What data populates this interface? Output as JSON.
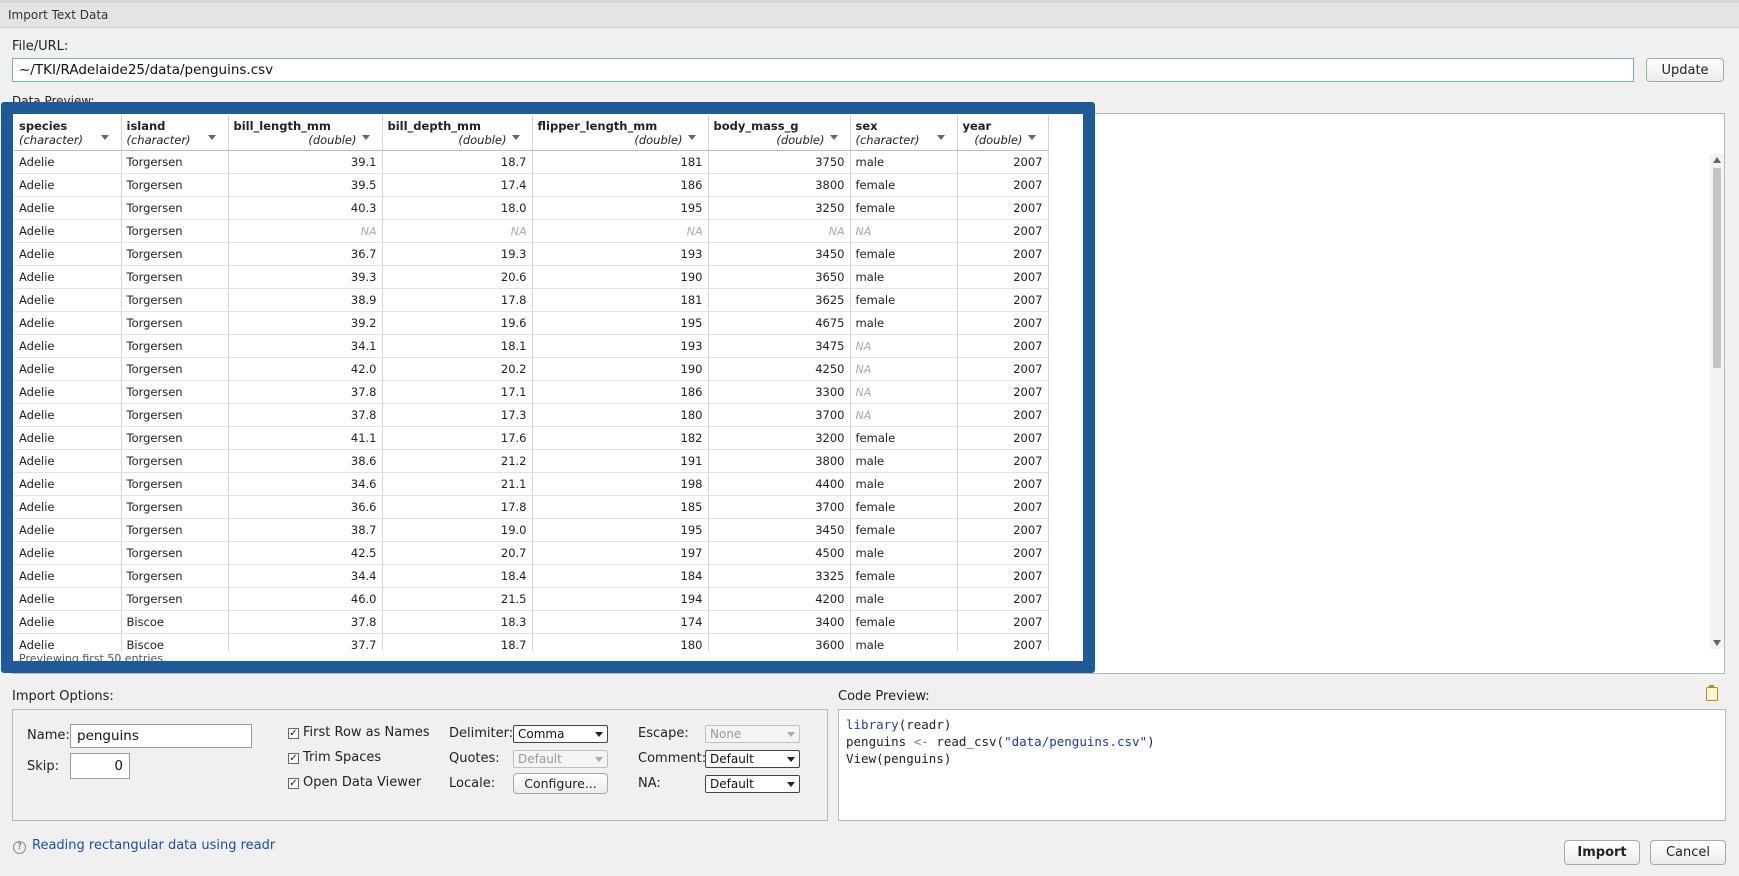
{
  "window": {
    "title": "Import Text Data"
  },
  "file": {
    "label": "File/URL:",
    "value": "~/TKI/RAdelaide25/data/penguins.csv",
    "update_label": "Update"
  },
  "preview": {
    "label": "Data Preview:",
    "footer": "Previewing first 50 entries.",
    "columns": [
      {
        "name": "species",
        "type": "(character)",
        "numeric": false
      },
      {
        "name": "island",
        "type": "(character)",
        "numeric": false
      },
      {
        "name": "bill_length_mm",
        "type": "(double)",
        "numeric": true
      },
      {
        "name": "bill_depth_mm",
        "type": "(double)",
        "numeric": true
      },
      {
        "name": "flipper_length_mm",
        "type": "(double)",
        "numeric": true
      },
      {
        "name": "body_mass_g",
        "type": "(double)",
        "numeric": true
      },
      {
        "name": "sex",
        "type": "(character)",
        "numeric": false
      },
      {
        "name": "year",
        "type": "(double)",
        "numeric": true
      }
    ],
    "rows": [
      [
        "Adelie",
        "Torgersen",
        "39.1",
        "18.7",
        "181",
        "3750",
        "male",
        "2007"
      ],
      [
        "Adelie",
        "Torgersen",
        "39.5",
        "17.4",
        "186",
        "3800",
        "female",
        "2007"
      ],
      [
        "Adelie",
        "Torgersen",
        "40.3",
        "18.0",
        "195",
        "3250",
        "female",
        "2007"
      ],
      [
        "Adelie",
        "Torgersen",
        "NA",
        "NA",
        "NA",
        "NA",
        "NA",
        "2007"
      ],
      [
        "Adelie",
        "Torgersen",
        "36.7",
        "19.3",
        "193",
        "3450",
        "female",
        "2007"
      ],
      [
        "Adelie",
        "Torgersen",
        "39.3",
        "20.6",
        "190",
        "3650",
        "male",
        "2007"
      ],
      [
        "Adelie",
        "Torgersen",
        "38.9",
        "17.8",
        "181",
        "3625",
        "female",
        "2007"
      ],
      [
        "Adelie",
        "Torgersen",
        "39.2",
        "19.6",
        "195",
        "4675",
        "male",
        "2007"
      ],
      [
        "Adelie",
        "Torgersen",
        "34.1",
        "18.1",
        "193",
        "3475",
        "NA",
        "2007"
      ],
      [
        "Adelie",
        "Torgersen",
        "42.0",
        "20.2",
        "190",
        "4250",
        "NA",
        "2007"
      ],
      [
        "Adelie",
        "Torgersen",
        "37.8",
        "17.1",
        "186",
        "3300",
        "NA",
        "2007"
      ],
      [
        "Adelie",
        "Torgersen",
        "37.8",
        "17.3",
        "180",
        "3700",
        "NA",
        "2007"
      ],
      [
        "Adelie",
        "Torgersen",
        "41.1",
        "17.6",
        "182",
        "3200",
        "female",
        "2007"
      ],
      [
        "Adelie",
        "Torgersen",
        "38.6",
        "21.2",
        "191",
        "3800",
        "male",
        "2007"
      ],
      [
        "Adelie",
        "Torgersen",
        "34.6",
        "21.1",
        "198",
        "4400",
        "male",
        "2007"
      ],
      [
        "Adelie",
        "Torgersen",
        "36.6",
        "17.8",
        "185",
        "3700",
        "female",
        "2007"
      ],
      [
        "Adelie",
        "Torgersen",
        "38.7",
        "19.0",
        "195",
        "3450",
        "female",
        "2007"
      ],
      [
        "Adelie",
        "Torgersen",
        "42.5",
        "20.7",
        "197",
        "4500",
        "male",
        "2007"
      ],
      [
        "Adelie",
        "Torgersen",
        "34.4",
        "18.4",
        "184",
        "3325",
        "female",
        "2007"
      ],
      [
        "Adelie",
        "Torgersen",
        "46.0",
        "21.5",
        "194",
        "4200",
        "male",
        "2007"
      ],
      [
        "Adelie",
        "Biscoe",
        "37.8",
        "18.3",
        "174",
        "3400",
        "female",
        "2007"
      ],
      [
        "Adelie",
        "Biscoe",
        "37.7",
        "18.7",
        "180",
        "3600",
        "male",
        "2007"
      ]
    ]
  },
  "options": {
    "label": "Import Options:",
    "name_label": "Name:",
    "name_value": "penguins",
    "skip_label": "Skip:",
    "skip_value": "0",
    "first_row_label": "First Row as Names",
    "first_row_checked": true,
    "trim_label": "Trim Spaces",
    "trim_checked": true,
    "open_viewer_label": "Open Data Viewer",
    "open_viewer_checked": true,
    "delimiter_label": "Delimiter:",
    "delimiter_value": "Comma",
    "quotes_label": "Quotes:",
    "quotes_value": "Default",
    "locale_label": "Locale:",
    "configure_label": "Configure...",
    "escape_label": "Escape:",
    "escape_value": "None",
    "comment_label": "Comment:",
    "comment_value": "Default",
    "na_label": "NA:",
    "na_value": "Default"
  },
  "code": {
    "label": "Code Preview:",
    "line1_fn": "library",
    "line1_arg": "(readr)",
    "line2_var": "penguins ",
    "line2_op": "<-",
    "line2_fn": " read_csv(",
    "line2_str": "\"data/penguins.csv\"",
    "line2_end": ")",
    "line3": "View(penguins)"
  },
  "footer": {
    "help_glyph": "?",
    "help_link": "Reading rectangular data using readr",
    "import_label": "Import",
    "cancel_label": "Cancel"
  },
  "colors": {
    "highlight": "#1e5a99",
    "link": "#1a4ea0"
  }
}
